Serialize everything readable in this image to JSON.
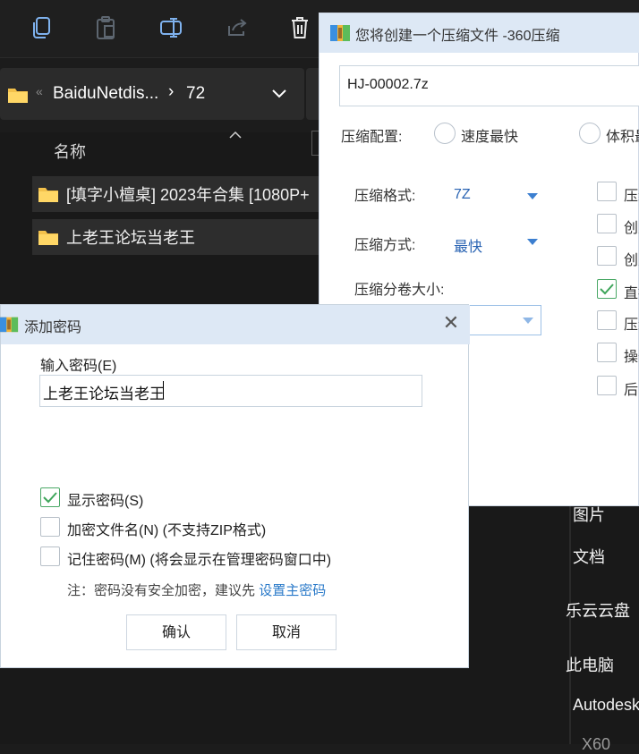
{
  "explorer": {
    "toolbar": {
      "copy_icon": "copy-icon",
      "paste_icon": "paste-icon",
      "rename_icon": "rename-icon",
      "share_icon": "share-icon",
      "delete_icon": "delete-icon"
    },
    "breadcrumb": {
      "overflow": "«",
      "item1": "BaiduNetdis...",
      "sep": "›",
      "item2": "72"
    },
    "column_name": "名称",
    "files": [
      {
        "name": "[填字小檀桌] 2023年合集 [1080P+"
      },
      {
        "name": "上老王论坛当老王"
      }
    ],
    "nav": {
      "pictures": "图片",
      "documents": "文档",
      "cloud": "乐云云盘",
      "this_pc": "此电脑",
      "autodesk": "Autodesk",
      "partial": "X60"
    }
  },
  "compress": {
    "title": "您将创建一个压缩文件 -360压缩",
    "filename": "HJ-00002.7z",
    "profile_label": "压缩配置:",
    "profile_fast": "速度最快",
    "profile_small": "体积最",
    "format_label": "压缩格式:",
    "format_value": "7Z",
    "method_label": "压缩方式:",
    "method_value": "最快",
    "volume_label": "压缩分卷大小:",
    "options": [
      {
        "label": "压缩",
        "checked": false
      },
      {
        "label": "创建",
        "checked": false
      },
      {
        "label": "创建",
        "checked": false
      },
      {
        "label": "直接",
        "checked": true
      },
      {
        "label": "压缩",
        "checked": false
      },
      {
        "label": "操作",
        "checked": false
      },
      {
        "label": "后台",
        "checked": false
      }
    ]
  },
  "password_dialog": {
    "title": "添加密码",
    "input_label": "输入密码(E)",
    "input_value": "上老王论坛当老王",
    "show_password": "显示密码(S)",
    "encrypt_names": "加密文件名(N) (不支持ZIP格式)",
    "remember": "记住密码(M) (将会显示在管理密码窗口中)",
    "note_prefix": "注：密码没有安全加密，建议先",
    "note_link": "设置主密码",
    "ok": "确认",
    "cancel": "取消",
    "show_password_checked": true,
    "encrypt_names_checked": false,
    "remember_checked": false
  }
}
